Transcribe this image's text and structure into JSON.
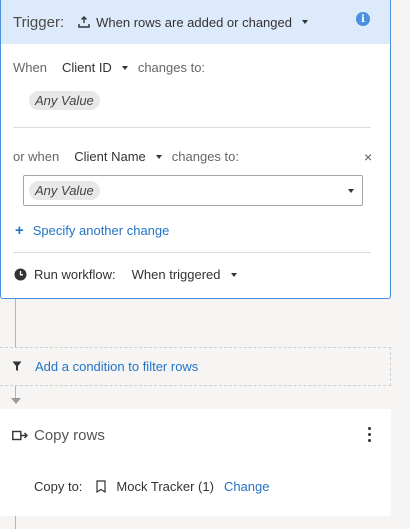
{
  "trigger": {
    "title": "Trigger:",
    "event": "When rows are added or changed",
    "info_icon": "info-icon"
  },
  "condition1": {
    "prefix": "When",
    "column": "Client ID",
    "suffix": "changes to:",
    "value": "Any Value"
  },
  "condition2": {
    "prefix": "or when",
    "column": "Client Name",
    "suffix": "changes to:",
    "value": "Any Value",
    "remove": "×"
  },
  "add_change": {
    "plus": "+",
    "label": "Specify another change"
  },
  "run": {
    "label": "Run workflow:",
    "value": "When triggered"
  },
  "filter": {
    "label": "Add a condition to filter rows"
  },
  "copy": {
    "title": "Copy rows",
    "copy_to_label": "Copy to:",
    "target": "Mock Tracker (1)",
    "change_link": "Change"
  },
  "colors": {
    "accent": "#4a90e2",
    "header_bg": "#ddeafb",
    "link": "#2374c6"
  }
}
